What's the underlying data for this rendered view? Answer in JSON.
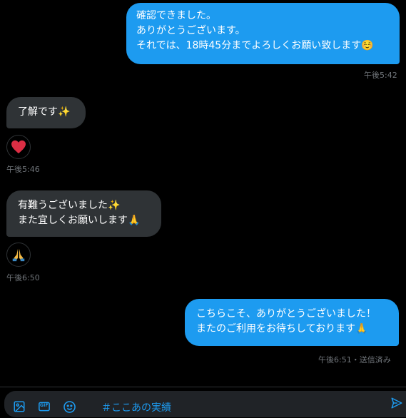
{
  "messages": [
    {
      "direction": "outgoing",
      "lines": [
        "確認できました。",
        "ありがとうございます。",
        "それでは、18時45分までよろしくお願い致します"
      ],
      "emoji": "☺️",
      "timestamp": "午後5:42"
    },
    {
      "direction": "incoming",
      "lines": [
        "了解です"
      ],
      "emoji": "✨",
      "reaction": "heart-icon",
      "timestamp": "午後5:46"
    },
    {
      "direction": "incoming",
      "lines": [
        "有難うございました",
        "また宜しくお願いします"
      ],
      "emoji_line1": "✨",
      "emoji_line2": "🙏",
      "reaction": "folded-hands-icon",
      "timestamp": "午後6:50"
    },
    {
      "direction": "outgoing",
      "lines": [
        "こちらこそ、ありがとうございました！",
        "またのご利用をお待ちしております"
      ],
      "emoji": "🙏",
      "timestamp": "午後6:51・送信済み"
    }
  ],
  "composer": {
    "input_value": "＃ここあの実績",
    "icons": [
      "image-icon",
      "gif-icon",
      "emoji-icon",
      "send-icon"
    ],
    "gif_label": "GIF"
  },
  "colors": {
    "background": "#000000",
    "outgoing_bubble": "#1d9bf0",
    "incoming_bubble": "#2f3336",
    "timestamp": "#71767b",
    "accent": "#1d9bf0"
  }
}
